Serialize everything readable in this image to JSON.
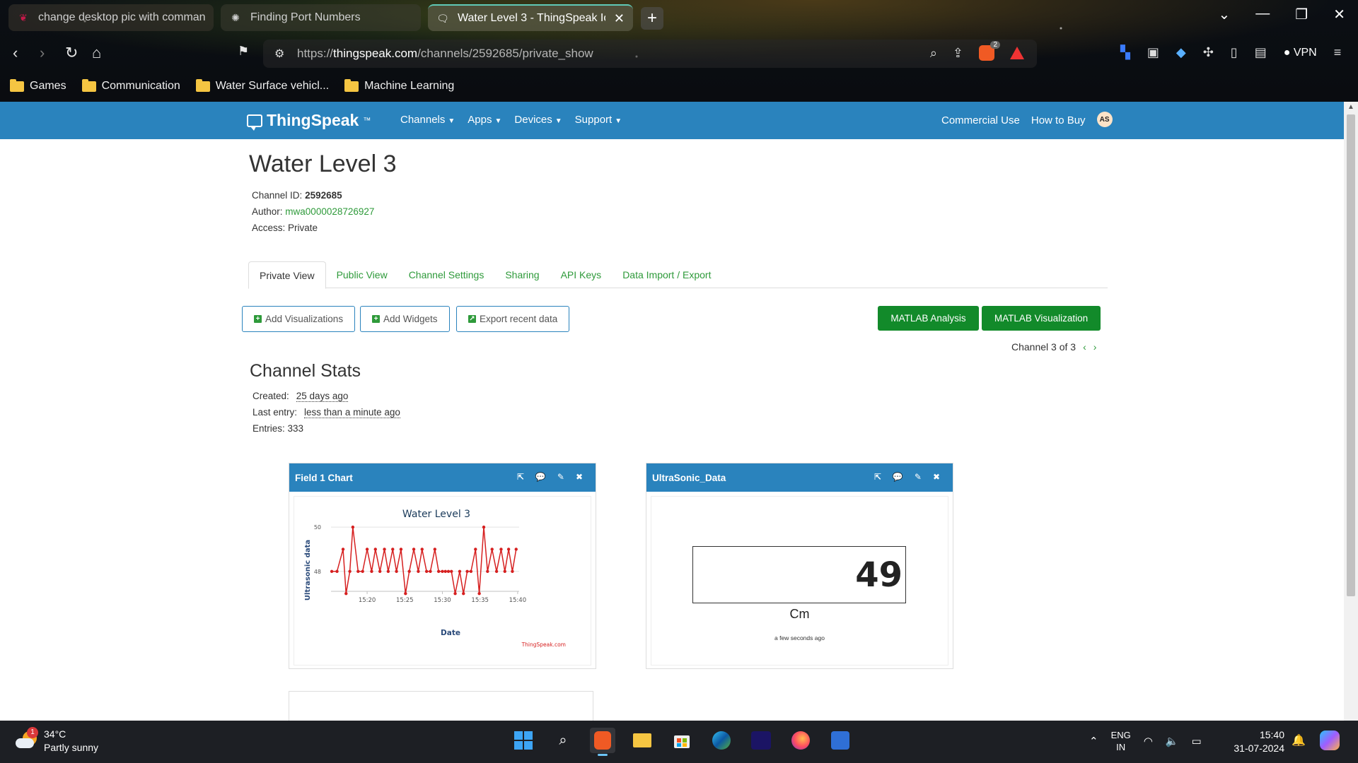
{
  "browser": {
    "tabs": [
      {
        "title": "change desktop pic with command",
        "icon": "raspberry-icon"
      },
      {
        "title": "Finding Port Numbers",
        "icon": "openai-icon"
      },
      {
        "title": "Water Level 3 - ThingSpeak IoT",
        "icon": "thingspeak-icon",
        "active": true
      }
    ],
    "url_prefix": "https://",
    "url_host": "thingspeak.com",
    "url_path": "/channels/2592685/private_show",
    "brave_badge_count": "2",
    "vpn_label": "VPN",
    "bookmarks": [
      "Games",
      "Communication",
      "Water Surface vehicl...",
      "Machine Learning"
    ]
  },
  "nav": {
    "logo": "ThingSpeak",
    "logo_tm": "™",
    "menu": [
      "Channels",
      "Apps",
      "Devices",
      "Support"
    ],
    "right": [
      "Commercial Use",
      "How to Buy"
    ],
    "avatar": "AS"
  },
  "channel": {
    "title": "Water Level 3",
    "id_label": "Channel ID:",
    "id": "2592685",
    "author_label": "Author:",
    "author": "mwa0000028726927",
    "access_label": "Access:",
    "access": "Private"
  },
  "tabs": [
    "Private View",
    "Public View",
    "Channel Settings",
    "Sharing",
    "API Keys",
    "Data Import / Export"
  ],
  "actions": {
    "add_visualizations": "Add Visualizations",
    "add_widgets": "Add Widgets",
    "export_recent": "Export recent data",
    "matlab_analysis": "MATLAB Analysis",
    "matlab_visualization": "MATLAB Visualization"
  },
  "pager": "Channel 3 of 3",
  "stats": {
    "title": "Channel Stats",
    "created_label": "Created:",
    "created": "25 days ago",
    "last_entry_label": "Last entry:",
    "last_entry": "less than a minute ago",
    "entries": "Entries: 333"
  },
  "widgets": {
    "chart_title": "Field 1 Chart",
    "numeric_title": "UltraSonic_Data",
    "numeric_value": "49",
    "numeric_unit": "Cm",
    "numeric_time": "a few seconds ago",
    "chart_credit": "ThingSpeak.com"
  },
  "chart_data": {
    "type": "line",
    "title": "Water Level 3",
    "xlabel": "Date",
    "ylabel": "Ultrasonic data",
    "ylim": [
      47.1,
      50.1
    ],
    "y_ticks": [
      48,
      50
    ],
    "x_ticks": [
      "15:20",
      "15:25",
      "15:30",
      "15:35",
      "15:40"
    ],
    "x_tick_minutes": [
      20,
      25,
      30,
      35,
      40
    ],
    "xlim_minutes": [
      15.2,
      40.2
    ],
    "color": "#d62020",
    "series": [
      {
        "x_minutes": [
          15.3,
          16.0,
          16.8,
          17.2,
          17.7,
          18.1,
          18.8,
          19.4,
          20.0,
          20.6,
          21.1,
          21.7,
          22.3,
          22.8,
          23.4,
          23.9,
          24.5,
          25.1,
          25.6,
          26.2,
          26.8,
          27.3,
          27.9,
          28.4,
          29.0,
          29.5,
          30.0,
          30.4,
          30.8,
          31.2,
          31.7,
          32.3,
          32.8,
          33.3,
          33.8,
          34.4,
          34.9,
          35.5,
          36.0,
          36.6,
          37.2,
          37.8,
          38.3,
          38.8,
          39.3,
          39.8
        ],
        "values": [
          48,
          48,
          49,
          47,
          48,
          50,
          48,
          48,
          49,
          48,
          49,
          48,
          49,
          48,
          49,
          48,
          49,
          47,
          48,
          49,
          48,
          49,
          48,
          48,
          49,
          48,
          48,
          48,
          48,
          48,
          47,
          48,
          47,
          48,
          48,
          49,
          47,
          50,
          48,
          49,
          48,
          49,
          48,
          49,
          48,
          49
        ]
      }
    ]
  }
}
